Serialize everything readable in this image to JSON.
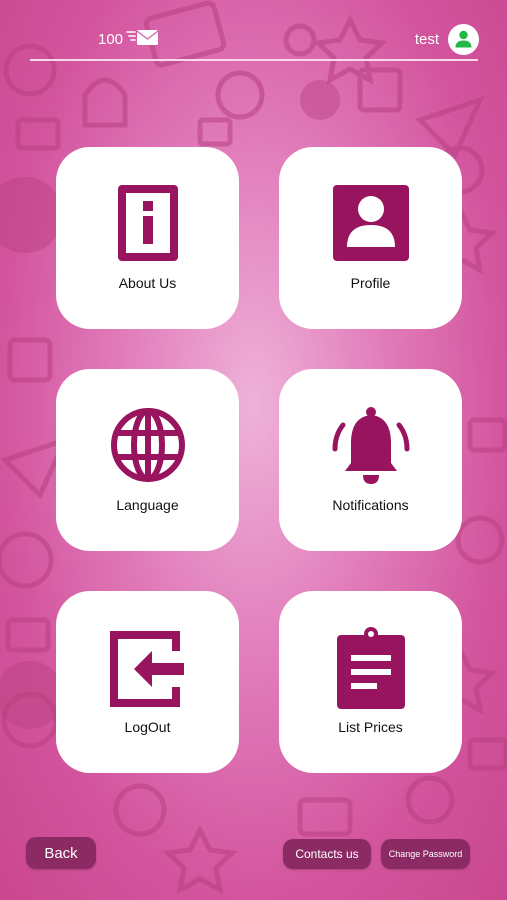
{
  "header": {
    "message_count": "100",
    "username": "test",
    "mail_icon": "fast-mail-icon",
    "avatar_icon": "user-icon"
  },
  "tiles": [
    {
      "label": "About Us",
      "icon": "info-icon"
    },
    {
      "label": "Profile",
      "icon": "profile-card-icon"
    },
    {
      "label": "Language",
      "icon": "globe-icon"
    },
    {
      "label": "Notifications",
      "icon": "bell-ringing-icon"
    },
    {
      "label": "LogOut",
      "icon": "logout-icon"
    },
    {
      "label": "List Prices",
      "icon": "clipboard-list-icon"
    }
  ],
  "footer": {
    "back_label": "Back",
    "contacts_label": "Contacts us",
    "change_password_label": "Change Password"
  },
  "colors": {
    "accent": "#99145e",
    "button": "#8c2a63",
    "background": "#e27fbd",
    "avatar_icon": "#22b845"
  }
}
